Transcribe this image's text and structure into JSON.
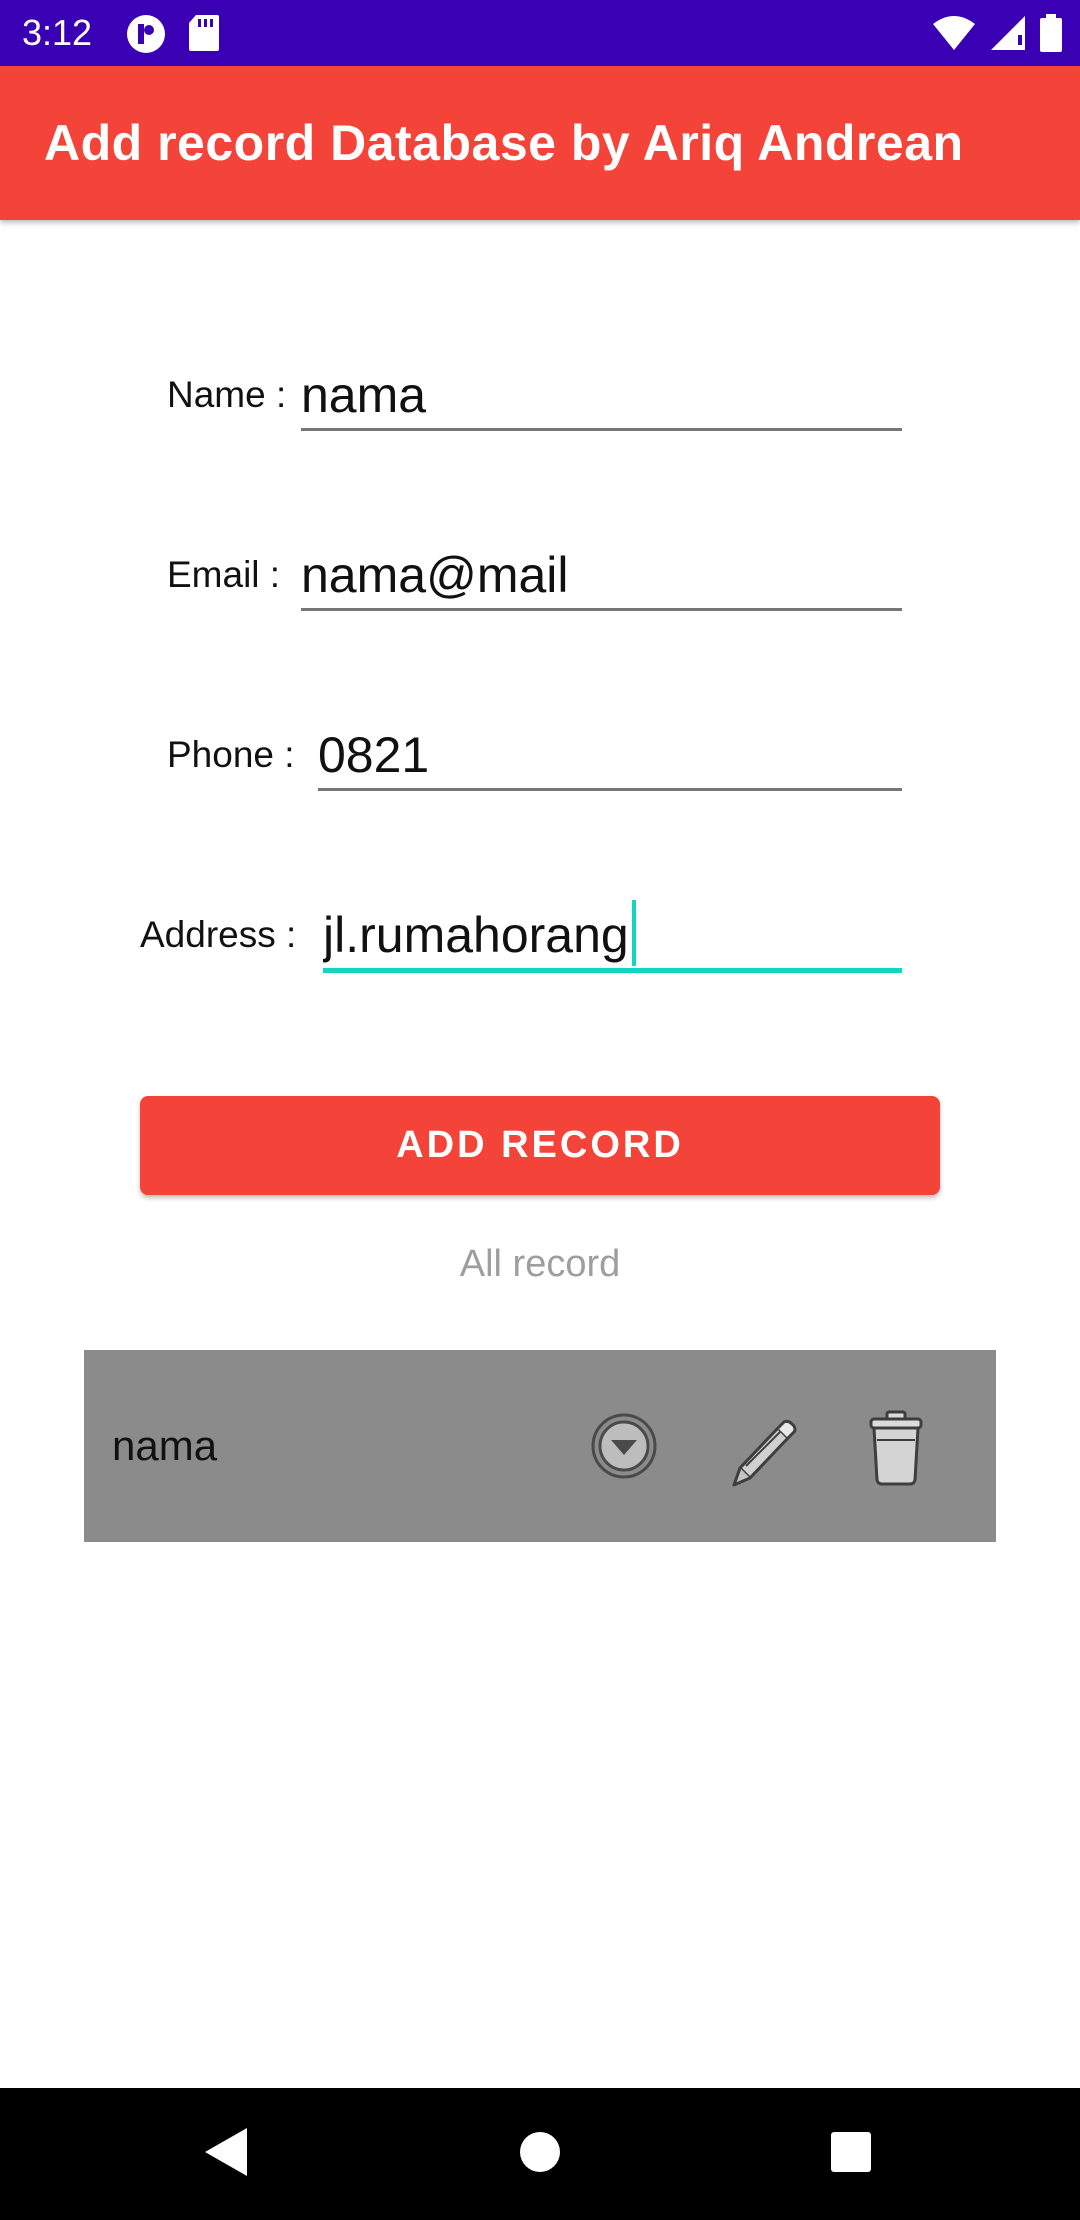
{
  "status_bar": {
    "time": "3:12"
  },
  "app_bar": {
    "title": "Add record Database by Ariq Andrean"
  },
  "form": {
    "name": {
      "label": "Name :",
      "value": "nama"
    },
    "email": {
      "label": "Email :",
      "value": "nama@mail"
    },
    "phone": {
      "label": "Phone :",
      "value": "0821"
    },
    "address": {
      "label": "Address :",
      "value": "jl.rumahorang"
    }
  },
  "add_button": {
    "label": "ADD RECORD"
  },
  "records_heading": "All record",
  "records": [
    {
      "name": "nama",
      "icons": [
        "expand-circle-icon",
        "pencil-icon",
        "trash-icon"
      ]
    }
  ],
  "colors": {
    "status_bar": "#3a00b4",
    "accent": "#f4443a",
    "focus_underline": "#13d5c2",
    "record_row": "#8c8b8c"
  }
}
